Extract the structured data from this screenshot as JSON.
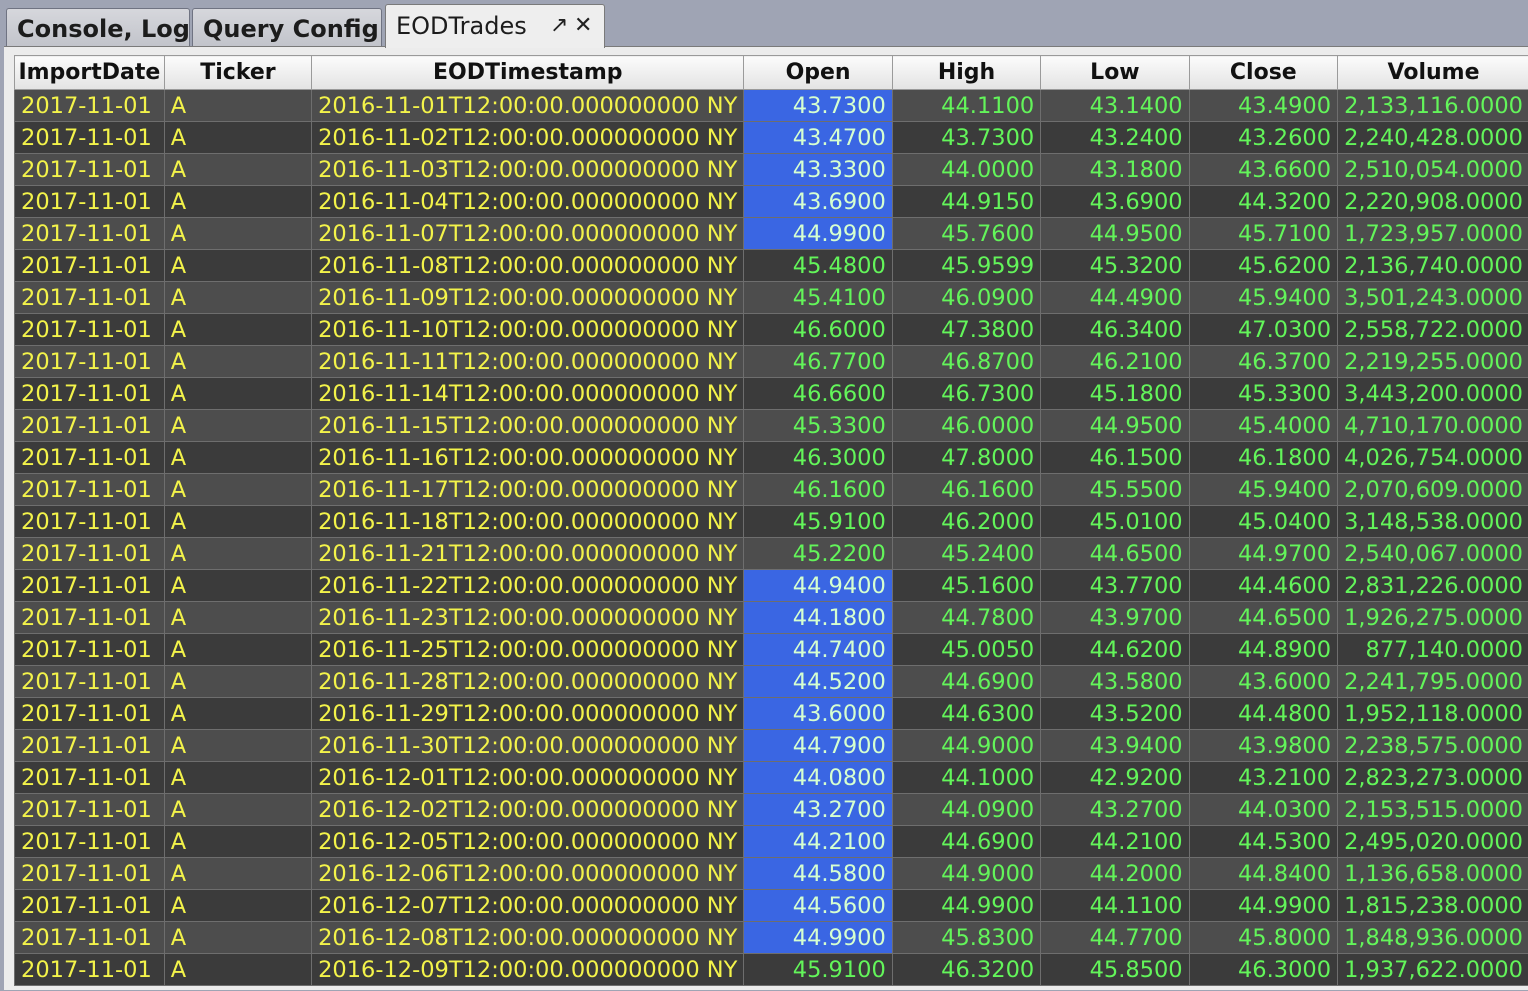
{
  "tabs": [
    {
      "label": "Console, Log",
      "active": false
    },
    {
      "label": "Query Config",
      "active": false
    },
    {
      "label": "EODTrades",
      "active": true
    }
  ],
  "tab_icons": {
    "popout": "popout-arrow-icon",
    "close": "close-x-icon"
  },
  "colors": {
    "text_string": "#f3f34a",
    "text_number": "#63f55a",
    "row_light": "#4d4d4d",
    "row_dark": "#3b3b3b",
    "highlight": "#3a66e3"
  },
  "columns": [
    "ImportDate",
    "Ticker",
    "EODTimestamp",
    "Open",
    "High",
    "Low",
    "Close",
    "Volume"
  ],
  "rows": [
    {
      "cells": [
        "2017-11-01",
        "A",
        "2016-11-01T12:00:00.000000000 NY",
        "43.7300",
        "44.1100",
        "43.1400",
        "43.4900",
        "2,133,116.0000"
      ],
      "open_highlighted": true
    },
    {
      "cells": [
        "2017-11-01",
        "A",
        "2016-11-02T12:00:00.000000000 NY",
        "43.4700",
        "43.7300",
        "43.2400",
        "43.2600",
        "2,240,428.0000"
      ],
      "open_highlighted": true
    },
    {
      "cells": [
        "2017-11-01",
        "A",
        "2016-11-03T12:00:00.000000000 NY",
        "43.3300",
        "44.0000",
        "43.1800",
        "43.6600",
        "2,510,054.0000"
      ],
      "open_highlighted": true
    },
    {
      "cells": [
        "2017-11-01",
        "A",
        "2016-11-04T12:00:00.000000000 NY",
        "43.6900",
        "44.9150",
        "43.6900",
        "44.3200",
        "2,220,908.0000"
      ],
      "open_highlighted": true
    },
    {
      "cells": [
        "2017-11-01",
        "A",
        "2016-11-07T12:00:00.000000000 NY",
        "44.9900",
        "45.7600",
        "44.9500",
        "45.7100",
        "1,723,957.0000"
      ],
      "open_highlighted": true
    },
    {
      "cells": [
        "2017-11-01",
        "A",
        "2016-11-08T12:00:00.000000000 NY",
        "45.4800",
        "45.9599",
        "45.3200",
        "45.6200",
        "2,136,740.0000"
      ],
      "open_highlighted": false
    },
    {
      "cells": [
        "2017-11-01",
        "A",
        "2016-11-09T12:00:00.000000000 NY",
        "45.4100",
        "46.0900",
        "44.4900",
        "45.9400",
        "3,501,243.0000"
      ],
      "open_highlighted": false
    },
    {
      "cells": [
        "2017-11-01",
        "A",
        "2016-11-10T12:00:00.000000000 NY",
        "46.6000",
        "47.3800",
        "46.3400",
        "47.0300",
        "2,558,722.0000"
      ],
      "open_highlighted": false
    },
    {
      "cells": [
        "2017-11-01",
        "A",
        "2016-11-11T12:00:00.000000000 NY",
        "46.7700",
        "46.8700",
        "46.2100",
        "46.3700",
        "2,219,255.0000"
      ],
      "open_highlighted": false
    },
    {
      "cells": [
        "2017-11-01",
        "A",
        "2016-11-14T12:00:00.000000000 NY",
        "46.6600",
        "46.7300",
        "45.1800",
        "45.3300",
        "3,443,200.0000"
      ],
      "open_highlighted": false
    },
    {
      "cells": [
        "2017-11-01",
        "A",
        "2016-11-15T12:00:00.000000000 NY",
        "45.3300",
        "46.0000",
        "44.9500",
        "45.4000",
        "4,710,170.0000"
      ],
      "open_highlighted": false
    },
    {
      "cells": [
        "2017-11-01",
        "A",
        "2016-11-16T12:00:00.000000000 NY",
        "46.3000",
        "47.8000",
        "46.1500",
        "46.1800",
        "4,026,754.0000"
      ],
      "open_highlighted": false
    },
    {
      "cells": [
        "2017-11-01",
        "A",
        "2016-11-17T12:00:00.000000000 NY",
        "46.1600",
        "46.1600",
        "45.5500",
        "45.9400",
        "2,070,609.0000"
      ],
      "open_highlighted": false
    },
    {
      "cells": [
        "2017-11-01",
        "A",
        "2016-11-18T12:00:00.000000000 NY",
        "45.9100",
        "46.2000",
        "45.0100",
        "45.0400",
        "3,148,538.0000"
      ],
      "open_highlighted": false
    },
    {
      "cells": [
        "2017-11-01",
        "A",
        "2016-11-21T12:00:00.000000000 NY",
        "45.2200",
        "45.2400",
        "44.6500",
        "44.9700",
        "2,540,067.0000"
      ],
      "open_highlighted": false
    },
    {
      "cells": [
        "2017-11-01",
        "A",
        "2016-11-22T12:00:00.000000000 NY",
        "44.9400",
        "45.1600",
        "43.7700",
        "44.4600",
        "2,831,226.0000"
      ],
      "open_highlighted": true
    },
    {
      "cells": [
        "2017-11-01",
        "A",
        "2016-11-23T12:00:00.000000000 NY",
        "44.1800",
        "44.7800",
        "43.9700",
        "44.6500",
        "1,926,275.0000"
      ],
      "open_highlighted": true
    },
    {
      "cells": [
        "2017-11-01",
        "A",
        "2016-11-25T12:00:00.000000000 NY",
        "44.7400",
        "45.0050",
        "44.6200",
        "44.8900",
        "877,140.0000"
      ],
      "open_highlighted": true
    },
    {
      "cells": [
        "2017-11-01",
        "A",
        "2016-11-28T12:00:00.000000000 NY",
        "44.5200",
        "44.6900",
        "43.5800",
        "43.6000",
        "2,241,795.0000"
      ],
      "open_highlighted": true
    },
    {
      "cells": [
        "2017-11-01",
        "A",
        "2016-11-29T12:00:00.000000000 NY",
        "43.6000",
        "44.6300",
        "43.5200",
        "44.4800",
        "1,952,118.0000"
      ],
      "open_highlighted": true
    },
    {
      "cells": [
        "2017-11-01",
        "A",
        "2016-11-30T12:00:00.000000000 NY",
        "44.7900",
        "44.9000",
        "43.9400",
        "43.9800",
        "2,238,575.0000"
      ],
      "open_highlighted": true
    },
    {
      "cells": [
        "2017-11-01",
        "A",
        "2016-12-01T12:00:00.000000000 NY",
        "44.0800",
        "44.1000",
        "42.9200",
        "43.2100",
        "2,823,273.0000"
      ],
      "open_highlighted": true
    },
    {
      "cells": [
        "2017-11-01",
        "A",
        "2016-12-02T12:00:00.000000000 NY",
        "43.2700",
        "44.0900",
        "43.2700",
        "44.0300",
        "2,153,515.0000"
      ],
      "open_highlighted": true
    },
    {
      "cells": [
        "2017-11-01",
        "A",
        "2016-12-05T12:00:00.000000000 NY",
        "44.2100",
        "44.6900",
        "44.2100",
        "44.5300",
        "2,495,020.0000"
      ],
      "open_highlighted": true
    },
    {
      "cells": [
        "2017-11-01",
        "A",
        "2016-12-06T12:00:00.000000000 NY",
        "44.5800",
        "44.9000",
        "44.2000",
        "44.8400",
        "1,136,658.0000"
      ],
      "open_highlighted": true
    },
    {
      "cells": [
        "2017-11-01",
        "A",
        "2016-12-07T12:00:00.000000000 NY",
        "44.5600",
        "44.9900",
        "44.1100",
        "44.9900",
        "1,815,238.0000"
      ],
      "open_highlighted": true
    },
    {
      "cells": [
        "2017-11-01",
        "A",
        "2016-12-08T12:00:00.000000000 NY",
        "44.9900",
        "45.8300",
        "44.7700",
        "45.8000",
        "1,848,936.0000"
      ],
      "open_highlighted": true
    },
    {
      "cells": [
        "2017-11-01",
        "A",
        "2016-12-09T12:00:00.000000000 NY",
        "45.9100",
        "46.3200",
        "45.8500",
        "46.3000",
        "1,937,622.0000"
      ],
      "open_highlighted": false
    }
  ]
}
